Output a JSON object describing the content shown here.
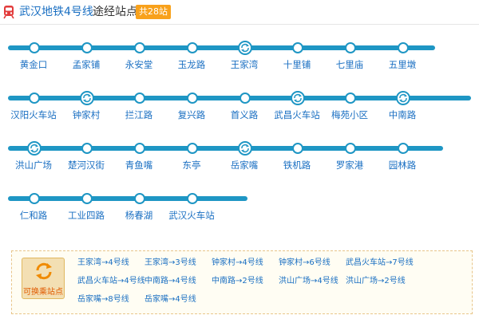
{
  "header": {
    "title": "武汉地铁4号线",
    "subtitle": "途经站点",
    "badge": "共28站"
  },
  "colors": {
    "line": "#1e96c4",
    "link": "#1a6fc2",
    "badge": "#f8a11b",
    "transfer_label": "#e05a00"
  },
  "rows": [
    {
      "stations": [
        {
          "name": "黄金口",
          "transfer": false
        },
        {
          "name": "孟家铺",
          "transfer": false
        },
        {
          "name": "永安堂",
          "transfer": false
        },
        {
          "name": "玉龙路",
          "transfer": false
        },
        {
          "name": "王家湾",
          "transfer": true
        },
        {
          "name": "十里铺",
          "transfer": false
        },
        {
          "name": "七里庙",
          "transfer": false
        },
        {
          "name": "五里墩",
          "transfer": false
        }
      ]
    },
    {
      "stations": [
        {
          "name": "汉阳火车站",
          "transfer": false
        },
        {
          "name": "钟家村",
          "transfer": true
        },
        {
          "name": "拦江路",
          "transfer": false
        },
        {
          "name": "复兴路",
          "transfer": false
        },
        {
          "name": "首义路",
          "transfer": false
        },
        {
          "name": "武昌火车站",
          "transfer": true
        },
        {
          "name": "梅苑小区",
          "transfer": false
        },
        {
          "name": "中南路",
          "transfer": true
        }
      ]
    },
    {
      "stations": [
        {
          "name": "洪山广场",
          "transfer": true
        },
        {
          "name": "楚河汉街",
          "transfer": false
        },
        {
          "name": "青鱼嘴",
          "transfer": false
        },
        {
          "name": "东亭",
          "transfer": false
        },
        {
          "name": "岳家嘴",
          "transfer": true
        },
        {
          "name": "铁机路",
          "transfer": false
        },
        {
          "name": "罗家港",
          "transfer": false
        },
        {
          "name": "园林路",
          "transfer": false
        }
      ]
    },
    {
      "stations": [
        {
          "name": "仁和路",
          "transfer": false
        },
        {
          "name": "工业四路",
          "transfer": false
        },
        {
          "name": "杨春湖",
          "transfer": false
        },
        {
          "name": "武汉火车站",
          "transfer": false
        }
      ]
    }
  ],
  "transfer": {
    "button_label": "可换乘站点",
    "button_icon": "refresh-arrows-icon",
    "items": [
      "王家湾→4号线",
      "王家湾→3号线",
      "钟家村→4号线",
      "钟家村→6号线",
      "武昌火车站→7号线",
      "武昌火车站→4号线",
      "中南路→4号线",
      "中南路→2号线",
      "洪山广场→4号线",
      "洪山广场→2号线",
      "岳家嘴→8号线",
      "岳家嘴→4号线"
    ]
  }
}
